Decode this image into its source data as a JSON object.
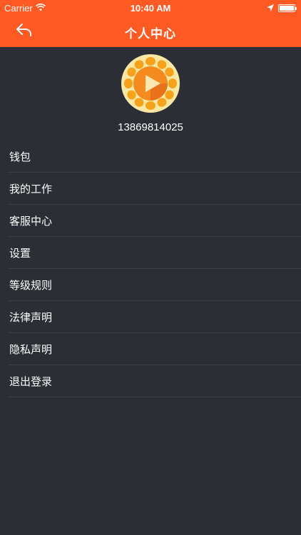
{
  "status_bar": {
    "carrier": "Carrier",
    "time": "10:40 AM"
  },
  "nav": {
    "title": "个人中心",
    "back_icon": "back-arrow-icon"
  },
  "profile": {
    "phone": "13869814025",
    "avatar_icon": "play-logo-icon"
  },
  "menu": {
    "items": [
      {
        "label": " 钱包"
      },
      {
        "label": "我的工作"
      },
      {
        "label": "客服中心"
      },
      {
        "label": "设置"
      },
      {
        "label": "等级规则"
      },
      {
        "label": "法律声明"
      },
      {
        "label": "隐私声明"
      },
      {
        "label": "退出登录"
      }
    ]
  },
  "colors": {
    "accent": "#ff5a23",
    "background": "#2b2e35",
    "divider": "#3c3f47"
  }
}
